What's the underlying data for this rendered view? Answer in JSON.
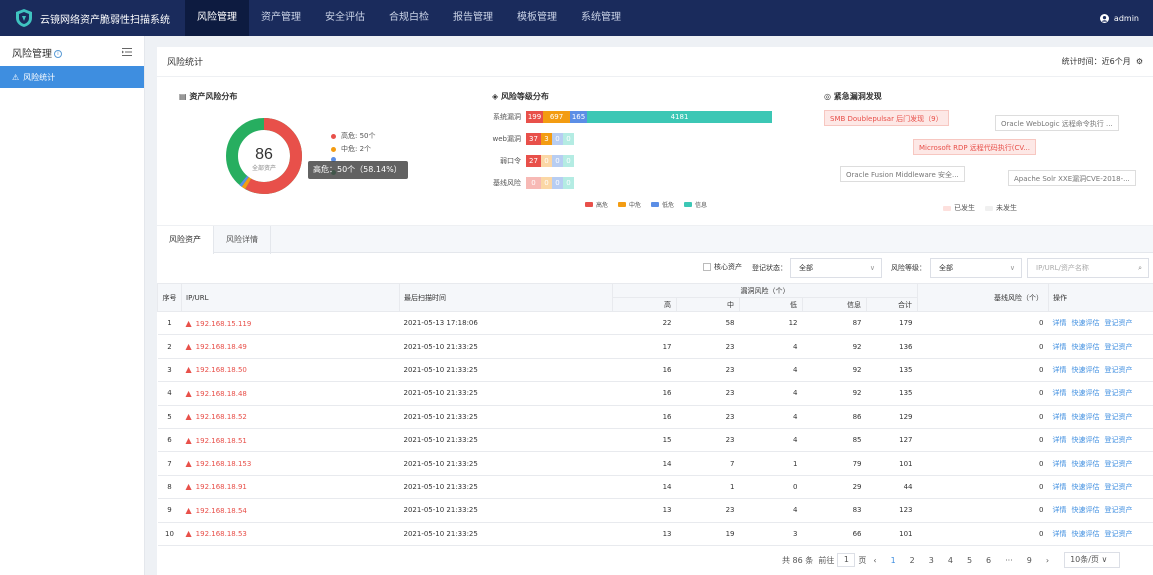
{
  "app": {
    "title": "云镜网络资产脆弱性扫描系统",
    "user": "admin"
  },
  "nav": [
    "风险管理",
    "资产管理",
    "安全评估",
    "合规白检",
    "报告管理",
    "模板管理",
    "系统管理"
  ],
  "sidebar": {
    "title": "风险管理",
    "info_mark": "i",
    "items": [
      "风险统计"
    ]
  },
  "section": {
    "title": "风险统计",
    "stat_time": "统计时间：近6个月"
  },
  "asset_risk": {
    "title": "资产风险分布",
    "total": "86",
    "total_label": "全部资产",
    "legend": [
      "高危: 50个",
      "中危: 2个"
    ],
    "tooltip": "高危：50个（58.14%）",
    "colors": {
      "high": "#e8504a",
      "medium": "#f39c12",
      "low": "#5b8ee6",
      "safe": "#27ae60"
    }
  },
  "risk_level": {
    "title": "风险等级分布",
    "rows": [
      {
        "label": "系统漏洞",
        "values": [
          "199",
          "697",
          "165",
          "4181"
        ]
      },
      {
        "label": "web漏洞",
        "values": [
          "37",
          "3",
          "0",
          "0"
        ]
      },
      {
        "label": "弱口令",
        "values": [
          "27",
          "0",
          "0",
          "0"
        ]
      },
      {
        "label": "基线风险",
        "values": [
          "0",
          "0",
          "0",
          "0"
        ]
      }
    ],
    "legend": [
      "高危",
      "中危",
      "低危",
      "信息"
    ]
  },
  "urgent": {
    "title": "紧急漏洞发现",
    "tags": [
      "SMB Doublepulsar 后门发现（9）",
      "Oracle WebLogic 远程命令执行 ...",
      "Microsoft RDP 远程代码执行(CV...",
      "Oracle Fusion Middleware 安全...",
      "Apache Solr XXE漏洞CVE-2018-..."
    ],
    "legend": [
      "已发生",
      "未发生"
    ]
  },
  "tabs": [
    "风险资产",
    "风险详情"
  ],
  "filters": {
    "core_asset": "核心资产",
    "reg_status_label": "登记状态：",
    "reg_status_value": "全部",
    "risk_level_label": "风险等级：",
    "risk_level_value": "全部",
    "search_placeholder": "IP/URL/资产名称"
  },
  "table": {
    "headers": {
      "no": "序号",
      "ip": "IP/URL",
      "time": "最后扫描时间",
      "vuln": "漏洞风险（个）",
      "high": "高",
      "mid": "中",
      "low": "低",
      "info": "信息",
      "total": "合计",
      "baseline": "基线风险（个）",
      "ops": "操作"
    },
    "rows": [
      [
        "1",
        "192.168.15.119",
        "2021-05-13 17:18:06",
        "22",
        "58",
        "12",
        "87",
        "179",
        "0"
      ],
      [
        "2",
        "192.168.18.49",
        "2021-05-10 21:33:25",
        "17",
        "23",
        "4",
        "92",
        "136",
        "0"
      ],
      [
        "3",
        "192.168.18.50",
        "2021-05-10 21:33:25",
        "16",
        "23",
        "4",
        "92",
        "135",
        "0"
      ],
      [
        "4",
        "192.168.18.48",
        "2021-05-10 21:33:25",
        "16",
        "23",
        "4",
        "92",
        "135",
        "0"
      ],
      [
        "5",
        "192.168.18.52",
        "2021-05-10 21:33:25",
        "16",
        "23",
        "4",
        "86",
        "129",
        "0"
      ],
      [
        "6",
        "192.168.18.51",
        "2021-05-10 21:33:25",
        "15",
        "23",
        "4",
        "85",
        "127",
        "0"
      ],
      [
        "7",
        "192.168.18.153",
        "2021-05-10 21:33:25",
        "14",
        "7",
        "1",
        "79",
        "101",
        "0"
      ],
      [
        "8",
        "192.168.18.91",
        "2021-05-10 21:33:25",
        "14",
        "1",
        "0",
        "29",
        "44",
        "0"
      ],
      [
        "9",
        "192.168.18.54",
        "2021-05-10 21:33:25",
        "13",
        "23",
        "4",
        "83",
        "123",
        "0"
      ],
      [
        "10",
        "192.168.18.53",
        "2021-05-10 21:33:25",
        "13",
        "19",
        "3",
        "66",
        "101",
        "0"
      ]
    ],
    "ops": [
      "详情",
      "快速评估",
      "登记资产"
    ]
  },
  "pagination": {
    "total": "共 86 条",
    "goto": "前往",
    "page": "1",
    "page_unit": "页",
    "pages": [
      "1",
      "2",
      "3",
      "4",
      "5",
      "6",
      "···",
      "9"
    ],
    "size": "10条/页"
  }
}
